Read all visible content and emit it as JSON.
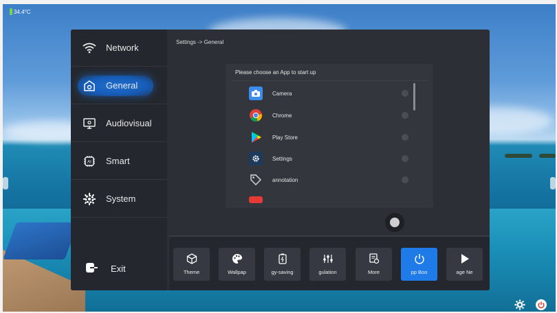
{
  "status": {
    "temperature": "34.4°C"
  },
  "sidebar": {
    "items": [
      {
        "label": "Network",
        "icon": "wifi-icon"
      },
      {
        "label": "General",
        "icon": "general-icon",
        "active": true
      },
      {
        "label": "Audiovisual",
        "icon": "monitor-icon"
      },
      {
        "label": "Smart",
        "icon": "ai-chip-icon"
      },
      {
        "label": "System",
        "icon": "system-gear-icon"
      }
    ],
    "exit_label": "Exit"
  },
  "breadcrumb": "Settings -> General",
  "chooser": {
    "title": "Please choose an App to start up",
    "apps": [
      {
        "name": "Camera",
        "icon": "camera-icon"
      },
      {
        "name": "Chrome",
        "icon": "chrome-icon"
      },
      {
        "name": "Play Store",
        "icon": "play-store-icon"
      },
      {
        "name": "Settings",
        "icon": "settings-icon"
      },
      {
        "name": "annotation",
        "icon": "tag-icon"
      }
    ]
  },
  "toolbar": {
    "items": [
      {
        "label": "Theme",
        "icon": "cube-icon"
      },
      {
        "label": "Wallpap",
        "icon": "palette-icon"
      },
      {
        "label": "gy-saving",
        "icon": "battery-icon"
      },
      {
        "label": "gulation",
        "icon": "sliders-icon"
      },
      {
        "label": "More",
        "icon": "more-icon"
      },
      {
        "label": "pp Boo",
        "icon": "power-icon",
        "active": true
      },
      {
        "label": "age Ne",
        "icon": "play-icon"
      }
    ]
  },
  "colors": {
    "accent": "#1e7be8",
    "panel": "#2c2f36",
    "sidebar": "#24272d"
  }
}
